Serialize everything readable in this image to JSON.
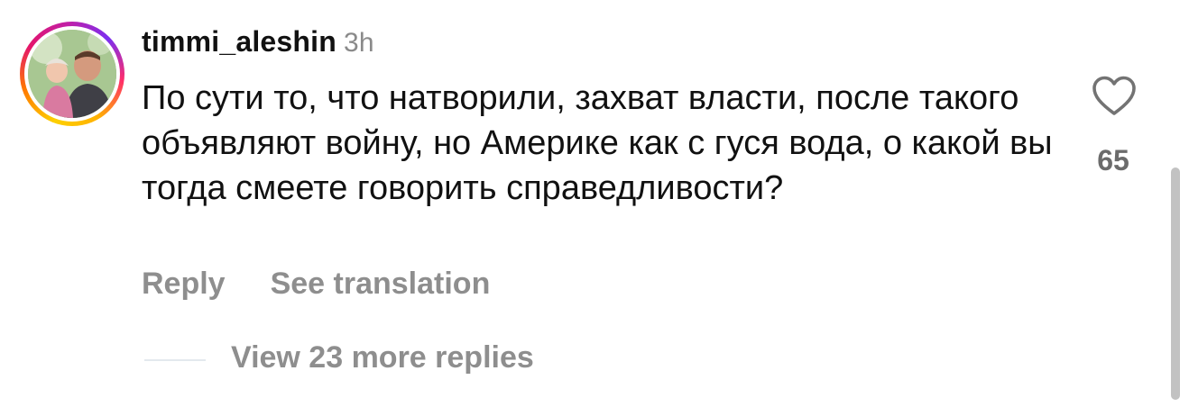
{
  "comment": {
    "username": "timmi_aleshin",
    "timestamp": "3h",
    "text": "По сути то, что натворили, захват власти, после такого объявляют войну, но Америке как с гуся вода, о какой вы тогда смеете говорить справедливости?",
    "like_count": "65"
  },
  "actions": {
    "reply_label": "Reply",
    "see_translation_label": "See translation"
  },
  "replies": {
    "view_more_label": "View 23 more replies"
  },
  "icons": {
    "like": "heart-icon"
  },
  "colors": {
    "story_ring": [
      "#fdd000",
      "#ff7a00",
      "#e4156b",
      "#c21fa6",
      "#7b2ff0"
    ],
    "secondary_text": "#8e8e8e"
  }
}
